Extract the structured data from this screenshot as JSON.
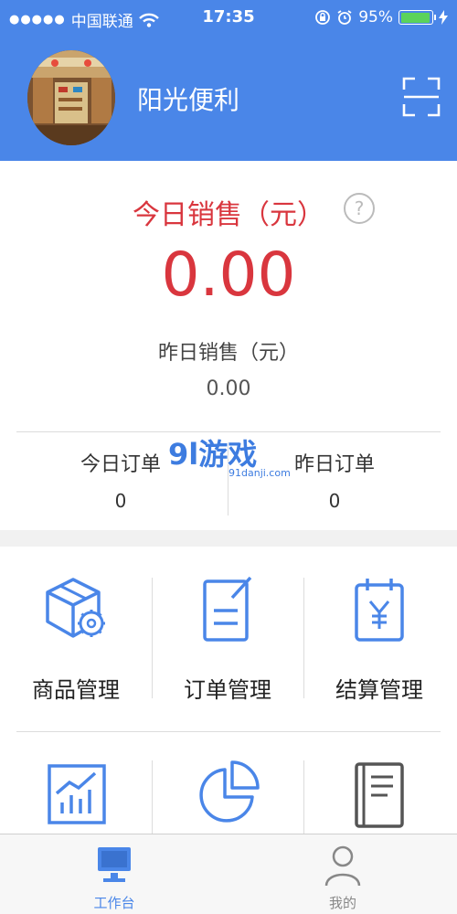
{
  "status_bar": {
    "carrier": "中国联通",
    "time": "17:35",
    "battery_percent": "95%",
    "battery_level": 0.95
  },
  "header": {
    "store_name": "阳光便利",
    "avatar_icon": "store-photo",
    "scan_icon": "scan-icon"
  },
  "sales": {
    "today_label": "今日销售（元）",
    "today_value": "0.00",
    "help_glyph": "?",
    "yesterday_label": "昨日销售（元）",
    "yesterday_value": "0.00"
  },
  "orders": {
    "today_label": "今日订单",
    "today_value": "0",
    "yesterday_label": "昨日订单",
    "yesterday_value": "0"
  },
  "watermark": {
    "brand": "9l游戏",
    "url": "91danji.com"
  },
  "tiles": [
    {
      "label": "商品管理",
      "icon": "box-gear-icon"
    },
    {
      "label": "订单管理",
      "icon": "document-edit-icon"
    },
    {
      "label": "结算管理",
      "icon": "yuan-calendar-icon"
    },
    {
      "label": "",
      "icon": "chart-icon"
    },
    {
      "label": "",
      "icon": "pie-chart-icon"
    },
    {
      "label": "",
      "icon": "book-icon"
    }
  ],
  "tabbar": {
    "workbench_label": "工作台",
    "mine_label": "我的"
  },
  "colors": {
    "brand_blue": "#4a86e8",
    "sales_red": "#d9363e",
    "icon_blue": "#4a86e8"
  }
}
